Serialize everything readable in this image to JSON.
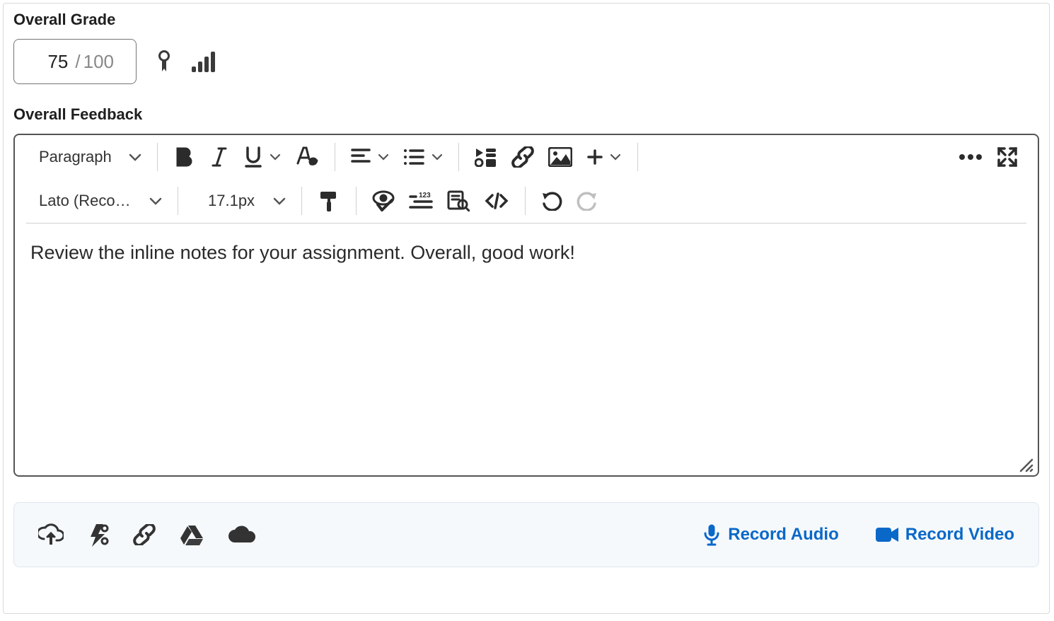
{
  "grade": {
    "label": "Overall Grade",
    "score": "75",
    "separator": "/",
    "max": "100"
  },
  "feedback": {
    "label": "Overall Feedback",
    "toolbar": {
      "block_format": "Paragraph",
      "font_name": "Lato (Recomm…",
      "font_size": "17.1px"
    },
    "content": "Review the inline notes for your assignment. Overall, good work!"
  },
  "attachments": {
    "record_audio": "Record Audio",
    "record_video": "Record Video"
  }
}
